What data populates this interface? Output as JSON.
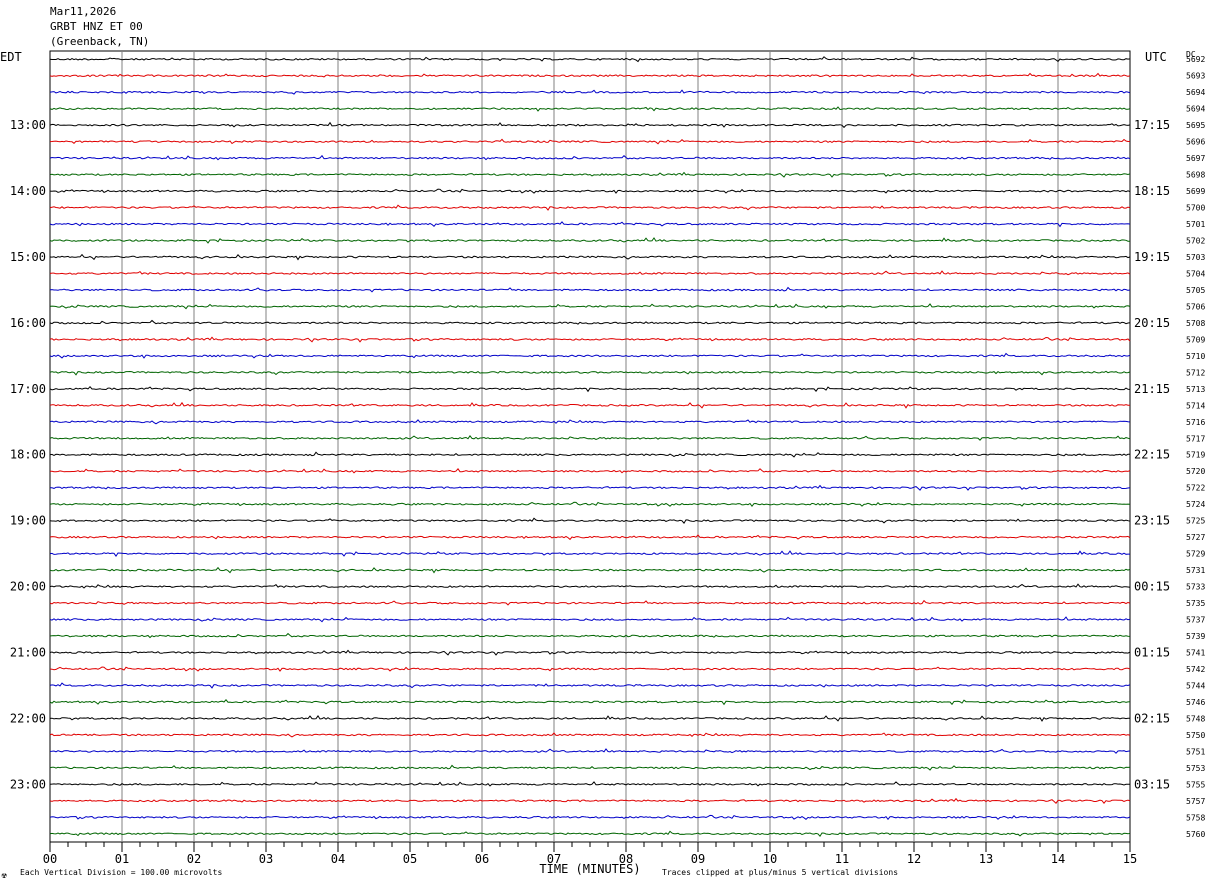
{
  "header": {
    "date": "Mar11,2026",
    "station": "GRBT HNZ ET 00",
    "location": "(Greenback, TN)"
  },
  "left_tz": "EDT",
  "right_tz": "UTC",
  "dc_label": "DC",
  "footer": {
    "scale": "Each Vertical Division =  100.00 microvolts",
    "xlabel": "TIME (MINUTES)",
    "clip": "Traces clipped at plus/minus 5 vertical divisions",
    "logo": "☢"
  },
  "colors": {
    "trace_cycle": [
      "#000000",
      "#e00000",
      "#0000c8",
      "#006400"
    ],
    "grid": "#808080",
    "frame": "#000000"
  },
  "chart_data": {
    "type": "line",
    "title": "",
    "xlabel": "TIME (MINUTES)",
    "x_ticks": [
      "00",
      "01",
      "02",
      "03",
      "04",
      "05",
      "06",
      "07",
      "08",
      "09",
      "10",
      "11",
      "12",
      "13",
      "14",
      "15"
    ],
    "xlim": [
      0,
      15
    ],
    "left_hour_labels": [
      "13:00",
      "14:00",
      "15:00",
      "16:00",
      "17:00",
      "18:00",
      "19:00",
      "20:00",
      "21:00",
      "22:00",
      "23:00"
    ],
    "right_hour_labels": [
      "17:15",
      "18:15",
      "19:15",
      "20:15",
      "21:15",
      "22:15",
      "23:15",
      "00:15",
      "01:15",
      "02:15",
      "03:15"
    ],
    "dc_offsets": [
      "5692",
      "5693",
      "5694",
      "5694",
      "5695",
      "5696",
      "5697",
      "5698",
      "5699",
      "5700",
      "5701",
      "5702",
      "5703",
      "5704",
      "5705",
      "5706",
      "5708",
      "5709",
      "5710",
      "5712",
      "5713",
      "5714",
      "5716",
      "5717",
      "5719",
      "5720",
      "5722",
      "5724",
      "5725",
      "5727",
      "5729",
      "5731",
      "5733",
      "5735",
      "5737",
      "5739",
      "5741",
      "5742",
      "5744",
      "5746",
      "5748",
      "5750",
      "5751",
      "5753",
      "5755",
      "5757",
      "5758",
      "5760"
    ]
  }
}
